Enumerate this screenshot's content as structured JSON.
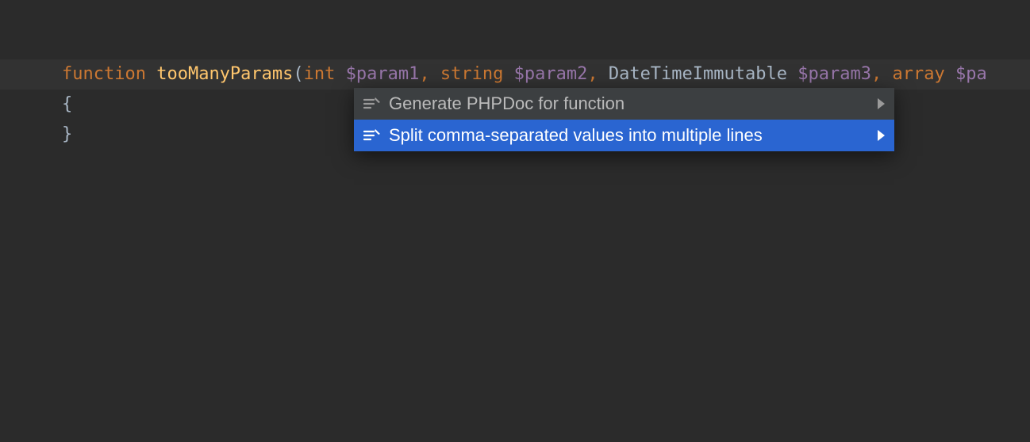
{
  "code": {
    "keyword_function": "function",
    "func_name": "tooManyParams",
    "paren_open": "(",
    "params": [
      {
        "type_tok": "int",
        "type_cls": "tok-type-int",
        "var": "$param1"
      },
      {
        "type_tok": "string",
        "type_cls": "tok-type-str",
        "var": "$param2"
      },
      {
        "type_tok": "DateTimeImmutable",
        "type_cls": "tok-type-cls",
        "var": "$param3"
      },
      {
        "type_tok": "array",
        "type_cls": "tok-type-arr",
        "var": "$pa"
      }
    ],
    "comma": ",",
    "brace_open": "{",
    "brace_close": "}"
  },
  "intention_actions": {
    "items": [
      {
        "label": "Generate PHPDoc for function",
        "selected": false,
        "has_submenu": true
      },
      {
        "label": "Split comma-separated values into multiple lines",
        "selected": true,
        "has_submenu": true
      }
    ]
  }
}
